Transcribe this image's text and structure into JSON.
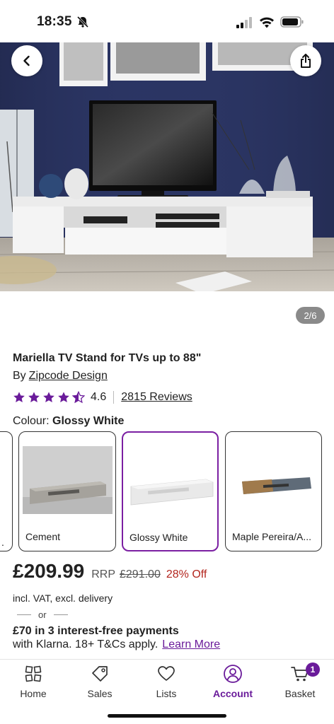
{
  "status_bar": {
    "time": "18:35"
  },
  "gallery": {
    "counter": "2/6"
  },
  "product": {
    "title": "Mariella TV Stand for TVs up to 88\"",
    "by_prefix": "By",
    "brand": "Zipcode Design",
    "rating_value": "4.6",
    "rating_fraction": 0.92,
    "reviews": "2815 Reviews"
  },
  "colour": {
    "label": "Colour:",
    "selected": "Glossy White",
    "options": [
      {
        "label": "Cement"
      },
      {
        "label": "Glossy White"
      },
      {
        "label": "Maple Pereira/A..."
      }
    ],
    "partial_left_label": "."
  },
  "pricing": {
    "price": "£209.99",
    "rrp_label": "RRP",
    "rrp_value": "£291.00",
    "discount": "28% Off",
    "vat_note": "incl. VAT, excl. delivery",
    "or_text": "or",
    "klarna_line1": "£70 in 3 interest-free payments",
    "klarna_line2": "with Klarna. 18+ T&Cs apply.",
    "learn_more": "Learn More"
  },
  "nav": {
    "items": [
      {
        "label": "Home",
        "icon": "home-icon"
      },
      {
        "label": "Sales",
        "icon": "tag-icon"
      },
      {
        "label": "Lists",
        "icon": "heart-icon"
      },
      {
        "label": "Account",
        "icon": "account-icon",
        "active": true
      },
      {
        "label": "Basket",
        "icon": "cart-icon"
      }
    ],
    "basket_count": "1"
  },
  "colors": {
    "accent": "#6a1b9a",
    "discount": "#b3261e",
    "wall": "#2b3563"
  }
}
